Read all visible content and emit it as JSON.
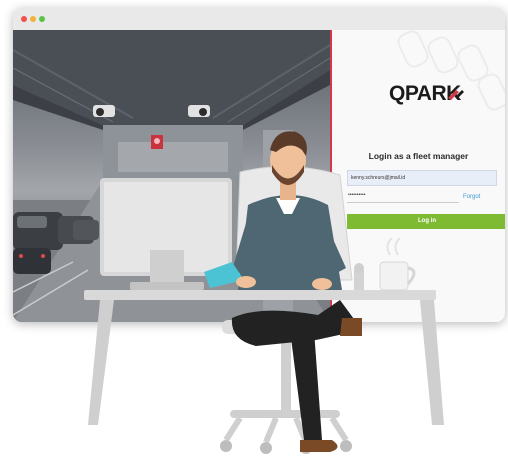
{
  "window": {
    "controls": [
      {
        "name": "close",
        "color": "#f0534a"
      },
      {
        "name": "minimize",
        "color": "#f2b33a"
      },
      {
        "name": "maximize",
        "color": "#59c24b"
      }
    ]
  },
  "photo": {
    "description_icon": "parking-garage-photo",
    "accent_color": "#d23a48"
  },
  "login": {
    "logo_text": "QPARK",
    "logo_icon": "q-park-swoosh-icon",
    "title": "Login as a fleet manager",
    "email_value": "kenny.schreurs@jmail.id",
    "password_mask": "••••••••••",
    "forgot_label": "Forgot",
    "button_label": "Log in",
    "brand_colors": {
      "button": "#7ebb33",
      "link": "#3c9bd2",
      "logo_accent": "#d23a48"
    }
  },
  "illustration": {
    "icon": "man-at-desk-illustration"
  }
}
